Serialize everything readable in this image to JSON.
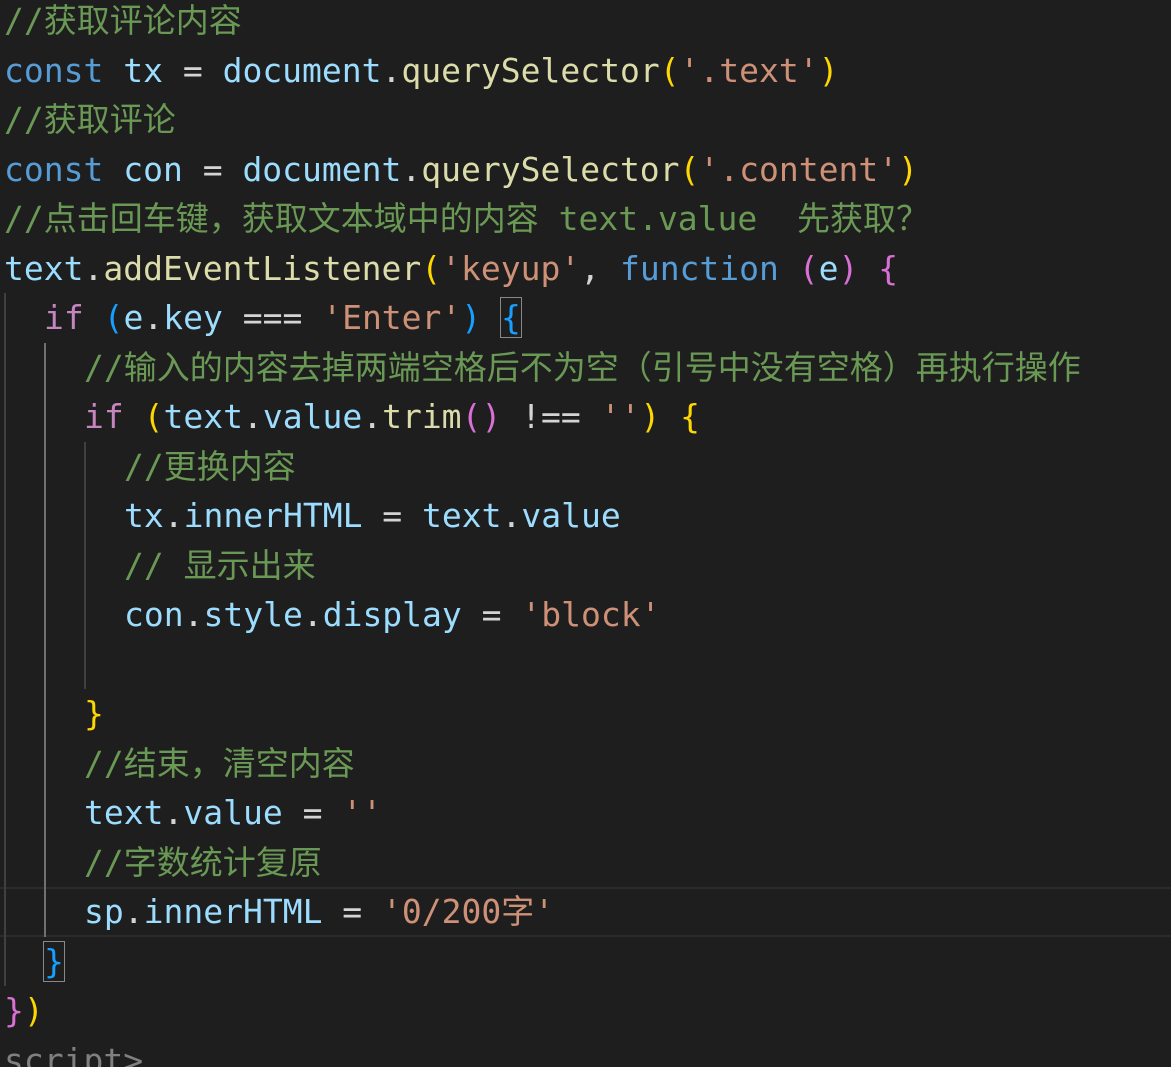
{
  "colors": {
    "background": "#1e1e1e",
    "comment": "#6a9955",
    "keyword_blue": "#569cd6",
    "control_purple": "#c586c0",
    "variable": "#9cdcfe",
    "function": "#dcdcaa",
    "string": "#ce9178",
    "bracket_gold": "#ffd700",
    "bracket_purple": "#da70d6",
    "bracket_blue": "#179fff",
    "punctuation": "#d4d4d4",
    "tag": "#808080"
  },
  "lines": [
    {
      "indent": 0,
      "tokens": [
        {
          "t": "//获取评论内容",
          "c": "comment"
        }
      ]
    },
    {
      "indent": 0,
      "tokens": [
        {
          "t": "const",
          "c": "keyword_blue"
        },
        {
          "t": " ",
          "c": "punctuation"
        },
        {
          "t": "tx",
          "c": "variable"
        },
        {
          "t": " = ",
          "c": "punctuation"
        },
        {
          "t": "document",
          "c": "variable"
        },
        {
          "t": ".",
          "c": "punctuation"
        },
        {
          "t": "querySelector",
          "c": "function"
        },
        {
          "t": "(",
          "c": "bracket_gold"
        },
        {
          "t": "'.text'",
          "c": "string"
        },
        {
          "t": ")",
          "c": "bracket_gold"
        }
      ]
    },
    {
      "indent": 0,
      "tokens": [
        {
          "t": "//获取评论",
          "c": "comment"
        }
      ]
    },
    {
      "indent": 0,
      "tokens": [
        {
          "t": "const",
          "c": "keyword_blue"
        },
        {
          "t": " ",
          "c": "punctuation"
        },
        {
          "t": "con",
          "c": "variable"
        },
        {
          "t": " = ",
          "c": "punctuation"
        },
        {
          "t": "document",
          "c": "variable"
        },
        {
          "t": ".",
          "c": "punctuation"
        },
        {
          "t": "querySelector",
          "c": "function"
        },
        {
          "t": "(",
          "c": "bracket_gold"
        },
        {
          "t": "'.content'",
          "c": "string"
        },
        {
          "t": ")",
          "c": "bracket_gold"
        }
      ]
    },
    {
      "indent": 0,
      "tokens": [
        {
          "t": "//点击回车键，获取文本域中的内容 text.value  先获取？",
          "c": "comment"
        }
      ]
    },
    {
      "indent": 0,
      "tokens": [
        {
          "t": "text",
          "c": "variable"
        },
        {
          "t": ".",
          "c": "punctuation"
        },
        {
          "t": "addEventListener",
          "c": "function"
        },
        {
          "t": "(",
          "c": "bracket_gold"
        },
        {
          "t": "'keyup'",
          "c": "string"
        },
        {
          "t": ", ",
          "c": "punctuation"
        },
        {
          "t": "function",
          "c": "keyword_blue"
        },
        {
          "t": " ",
          "c": "punctuation"
        },
        {
          "t": "(",
          "c": "bracket_purple"
        },
        {
          "t": "e",
          "c": "variable"
        },
        {
          "t": ")",
          "c": "bracket_purple"
        },
        {
          "t": " ",
          "c": "punctuation"
        },
        {
          "t": "{",
          "c": "bracket_purple"
        }
      ]
    },
    {
      "indent": 1,
      "tokens": [
        {
          "t": "if",
          "c": "control_purple"
        },
        {
          "t": " ",
          "c": "punctuation"
        },
        {
          "t": "(",
          "c": "bracket_blue"
        },
        {
          "t": "e",
          "c": "variable"
        },
        {
          "t": ".",
          "c": "punctuation"
        },
        {
          "t": "key",
          "c": "variable"
        },
        {
          "t": " === ",
          "c": "punctuation"
        },
        {
          "t": "'Enter'",
          "c": "string"
        },
        {
          "t": ")",
          "c": "bracket_blue"
        },
        {
          "t": " ",
          "c": "punctuation"
        },
        {
          "t": "{",
          "c": "bracket_blue",
          "match": true
        }
      ]
    },
    {
      "indent": 2,
      "tokens": [
        {
          "t": "//输入的内容去掉两端空格后不为空（引号中没有空格）再执行操作",
          "c": "comment"
        }
      ]
    },
    {
      "indent": 2,
      "tokens": [
        {
          "t": "if",
          "c": "control_purple"
        },
        {
          "t": " ",
          "c": "punctuation"
        },
        {
          "t": "(",
          "c": "bracket_gold"
        },
        {
          "t": "text",
          "c": "variable"
        },
        {
          "t": ".",
          "c": "punctuation"
        },
        {
          "t": "value",
          "c": "variable"
        },
        {
          "t": ".",
          "c": "punctuation"
        },
        {
          "t": "trim",
          "c": "function"
        },
        {
          "t": "(",
          "c": "bracket_purple"
        },
        {
          "t": ")",
          "c": "bracket_purple"
        },
        {
          "t": " !== ",
          "c": "punctuation"
        },
        {
          "t": "''",
          "c": "string"
        },
        {
          "t": ")",
          "c": "bracket_gold"
        },
        {
          "t": " ",
          "c": "punctuation"
        },
        {
          "t": "{",
          "c": "bracket_gold"
        }
      ]
    },
    {
      "indent": 3,
      "tokens": [
        {
          "t": "//更换内容",
          "c": "comment"
        }
      ]
    },
    {
      "indent": 3,
      "tokens": [
        {
          "t": "tx",
          "c": "variable"
        },
        {
          "t": ".",
          "c": "punctuation"
        },
        {
          "t": "innerHTML",
          "c": "variable"
        },
        {
          "t": " = ",
          "c": "punctuation"
        },
        {
          "t": "text",
          "c": "variable"
        },
        {
          "t": ".",
          "c": "punctuation"
        },
        {
          "t": "value",
          "c": "variable"
        }
      ]
    },
    {
      "indent": 3,
      "tokens": [
        {
          "t": "// 显示出来",
          "c": "comment"
        }
      ]
    },
    {
      "indent": 3,
      "tokens": [
        {
          "t": "con",
          "c": "variable"
        },
        {
          "t": ".",
          "c": "punctuation"
        },
        {
          "t": "style",
          "c": "variable"
        },
        {
          "t": ".",
          "c": "punctuation"
        },
        {
          "t": "display",
          "c": "variable"
        },
        {
          "t": " = ",
          "c": "punctuation"
        },
        {
          "t": "'block'",
          "c": "string"
        }
      ]
    },
    {
      "indent": 3,
      "tokens": []
    },
    {
      "indent": 2,
      "tokens": [
        {
          "t": "}",
          "c": "bracket_gold"
        }
      ]
    },
    {
      "indent": 2,
      "tokens": [
        {
          "t": "//结束，清空内容",
          "c": "comment"
        }
      ]
    },
    {
      "indent": 2,
      "tokens": [
        {
          "t": "text",
          "c": "variable"
        },
        {
          "t": ".",
          "c": "punctuation"
        },
        {
          "t": "value",
          "c": "variable"
        },
        {
          "t": " = ",
          "c": "punctuation"
        },
        {
          "t": "''",
          "c": "string"
        }
      ]
    },
    {
      "indent": 2,
      "tokens": [
        {
          "t": "//字数统计复原",
          "c": "comment"
        }
      ]
    },
    {
      "indent": 2,
      "current": true,
      "tokens": [
        {
          "t": "sp",
          "c": "variable"
        },
        {
          "t": ".",
          "c": "punctuation"
        },
        {
          "t": "innerHTML",
          "c": "variable"
        },
        {
          "t": " = ",
          "c": "punctuation"
        },
        {
          "t": "'0/200字'",
          "c": "string"
        }
      ]
    },
    {
      "indent": 1,
      "tokens": [
        {
          "t": "}",
          "c": "bracket_blue",
          "match": true
        }
      ]
    },
    {
      "indent": 0,
      "tokens": [
        {
          "t": "}",
          "c": "bracket_purple"
        },
        {
          "t": ")",
          "c": "bracket_gold"
        }
      ]
    },
    {
      "indent": 0,
      "tokens": [
        {
          "t": "script",
          "c": "tag"
        },
        {
          "t": ">",
          "c": "tag"
        }
      ]
    }
  ]
}
